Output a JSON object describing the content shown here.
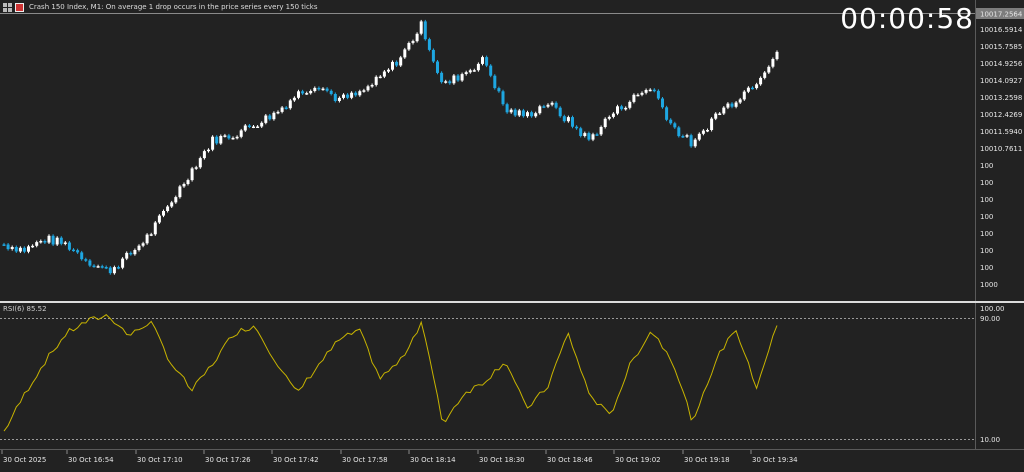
{
  "header": {
    "title": "Crash 150 Index, M1:  On average 1 drop occurs in the price series every 150 ticks"
  },
  "timer": "00:00:58",
  "price_axis": {
    "current_price": "10017.2564",
    "labels": [
      "10016.5914",
      "10015.7585",
      "10014.9256",
      "10014.0927",
      "10013.2598",
      "10012.4269",
      "10011.5940",
      "10010.7611"
    ],
    "truncated_labels": [
      "100",
      "100",
      "100",
      "100",
      "100",
      "100",
      "100",
      "100"
    ],
    "bottom_label": "1000"
  },
  "rsi": {
    "label": "RSI(6) 85.52",
    "levels": [
      "100.00",
      "90.00",
      "10.00"
    ]
  },
  "time_axis": [
    "30 Oct 2025",
    "30 Oct 16:54",
    "30 Oct 17:10",
    "30 Oct 17:26",
    "30 Oct 17:42",
    "30 Oct 17:58",
    "30 Oct 18:14",
    "30 Oct 18:30",
    "30 Oct 18:46",
    "30 Oct 19:02",
    "30 Oct 19:18",
    "30 Oct 19:34"
  ],
  "colors": {
    "background": "#222222",
    "bull_candle": "#ffffff",
    "bear_candle": "#1ea7e1",
    "rsi_line": "#c8b400",
    "separator": "#dcdcdc",
    "level_dash": "#9a9a9a"
  },
  "chart_data": {
    "type": "candlestick",
    "symbol": "Crash 150 Index",
    "timeframe": "M1",
    "indicator": "RSI(6)",
    "indicator_last": 85.52,
    "price_ylim": [
      10007.0,
      10017.6
    ],
    "rsi_levels": [
      90,
      10
    ],
    "price_path": [
      10009.0,
      10008.8,
      10009.2,
      10009.0,
      10008.4,
      10008.0,
      10008.6,
      10009.4,
      10010.6,
      10011.8,
      10012.9,
      10013.1,
      10013.5,
      10013.9,
      10014.6,
      10015.0,
      10014.4,
      10014.6,
      10015.2,
      10016.0,
      10017.2,
      10014.9,
      10015.4,
      10015.9,
      10014.0,
      10013.8,
      10014.3,
      10013.6,
      10012.9,
      10013.8,
      10014.4,
      10014.9,
      10013.4,
      10012.7,
      10013.8,
      10014.4,
      10015.1,
      10016.2
    ],
    "rsi_path": [
      15,
      40,
      62,
      80,
      88,
      92,
      78,
      88,
      60,
      42,
      60,
      80,
      85,
      62,
      40,
      58,
      75,
      82,
      50,
      62,
      88,
      20,
      40,
      48,
      62,
      30,
      44,
      80,
      40,
      25,
      60,
      82,
      62,
      20,
      60,
      84,
      44,
      85
    ]
  }
}
